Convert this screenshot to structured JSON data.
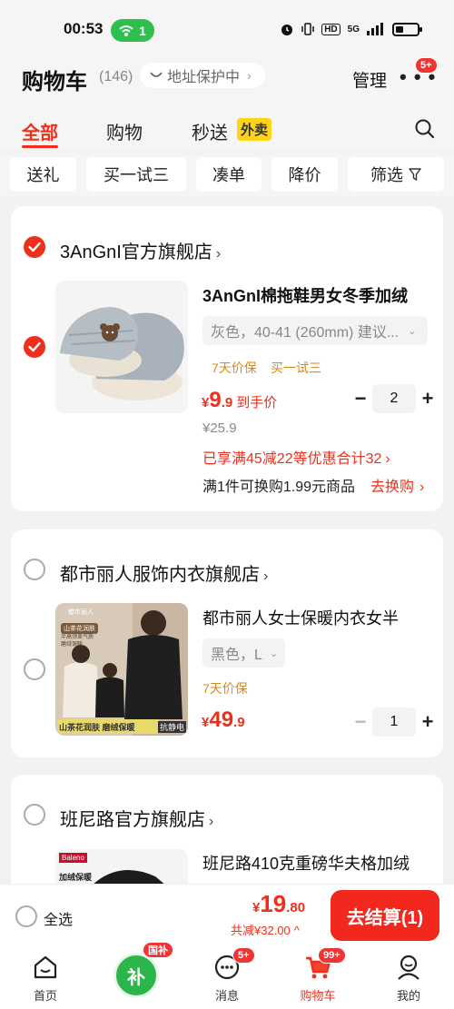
{
  "status": {
    "time": "00:53",
    "wifi_count": "1",
    "network": "5G",
    "hd": "HD"
  },
  "header": {
    "title": "购物车",
    "count": "(146)",
    "address": "地址保护中",
    "manage": "管理",
    "more_badge": "5+"
  },
  "tabs": {
    "all": "全部",
    "shop": "购物",
    "flash": "秒送",
    "waimai": "外卖"
  },
  "filters": [
    "送礼",
    "买一试三",
    "凑单",
    "降价",
    "筛选"
  ],
  "stores": [
    {
      "name": "3AnGnI官方旗舰店",
      "checked": true,
      "product": {
        "title": "3AnGnI棉拖鞋男女冬季加绒",
        "sku": "灰色，40-41 (260mm) 建议...",
        "tags": [
          "7天价保",
          "买一试三"
        ],
        "price_symbol": "¥",
        "price_int": "9",
        "price_dec": ".9",
        "price_note": "到手价",
        "orig_price": "¥25.9",
        "promo": "已享满45减22等优惠合计32",
        "exchange": "满1件可换购1.99元商品",
        "exchange_link": "去换购",
        "qty": "2"
      }
    },
    {
      "name": "都市丽人服饰内衣旗舰店",
      "checked": false,
      "product": {
        "title": "都市丽人女士保暖内衣女半",
        "sku": "黑色，L",
        "tags": [
          "7天价保"
        ],
        "price_symbol": "¥",
        "price_int": "49",
        "price_dec": ".9",
        "qty": "1",
        "img_brand": "都市丽人",
        "img_badge": "山茶花润肤",
        "img_sub": "半高领显气质 磨绒保暖",
        "img_banner": "山茶花润肤 磨绒保暖",
        "img_tag": "抗静电"
      }
    },
    {
      "name": "班尼路官方旗舰店",
      "checked": false,
      "product": {
        "title": "班尼路410克重磅华夫格加绒",
        "img_brand": "Baleno",
        "img_badge": "加绒保暖"
      }
    }
  ],
  "bottom": {
    "select_all": "全选",
    "total_symbol": "¥",
    "total_int": "19",
    "total_dec": ".80",
    "discount": "共减¥32.00",
    "checkout": "去结算(1)"
  },
  "nav": [
    {
      "label": "首页",
      "icon": "home-icon"
    },
    {
      "label": "",
      "icon": "subsidy-icon",
      "badge": "国补",
      "glyph": "补"
    },
    {
      "label": "消息",
      "icon": "message-icon",
      "badge": "5+"
    },
    {
      "label": "购物车",
      "icon": "cart-icon",
      "badge": "99+",
      "active": true
    },
    {
      "label": "我的",
      "icon": "profile-icon"
    }
  ],
  "colors": {
    "accent": "#f02e1c",
    "waimai": "#ffd31a",
    "tag": "#d88a1c",
    "wifi": "#2fbf4f"
  }
}
